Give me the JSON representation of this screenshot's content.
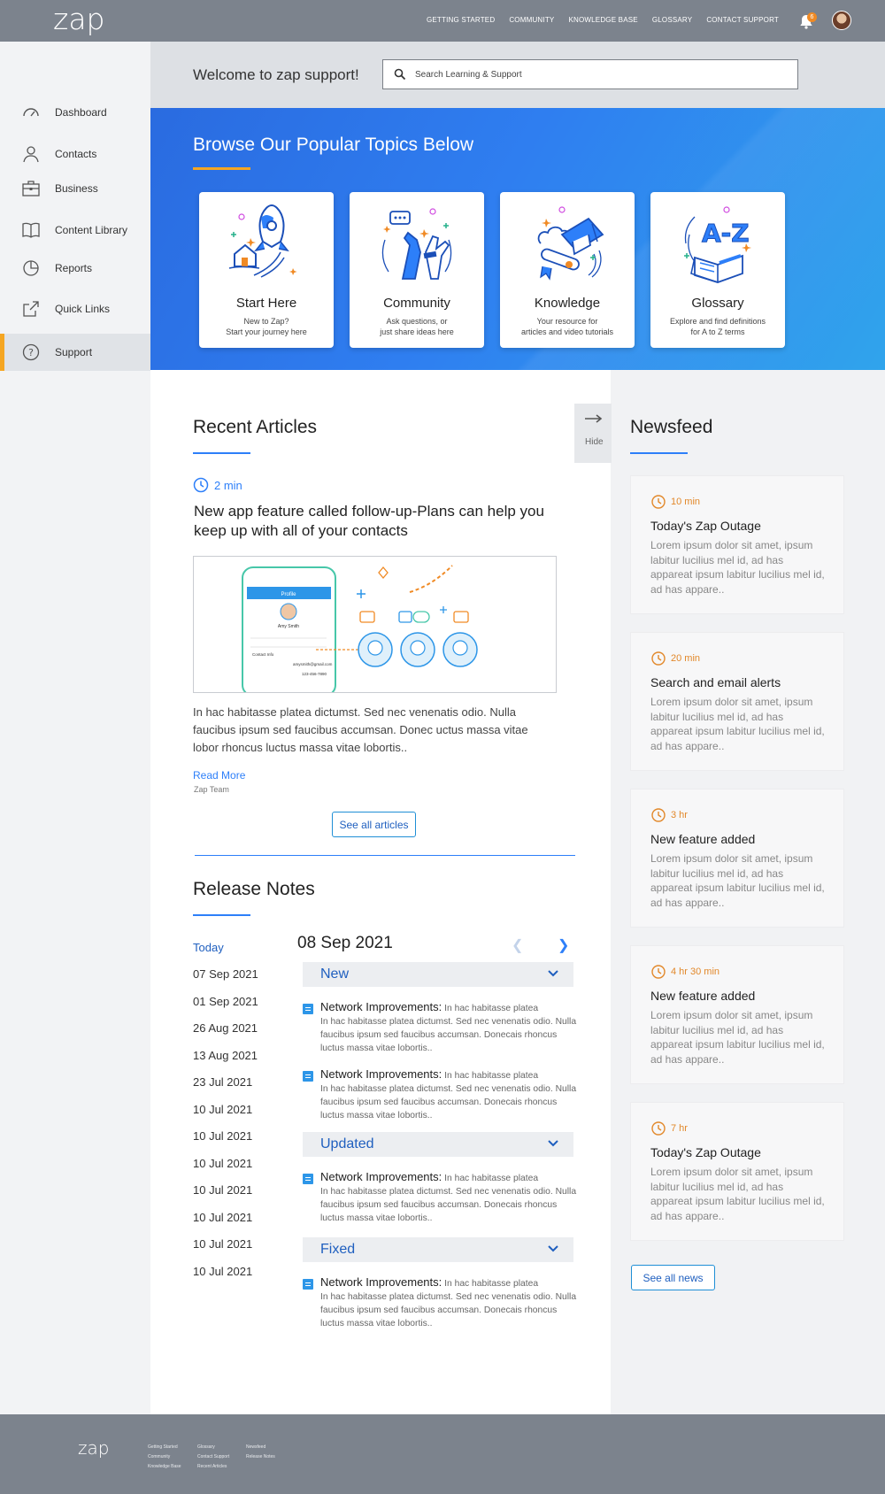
{
  "header": {
    "logo": "zap",
    "nav": [
      "GETTING STARTED",
      "COMMUNITY",
      "KNOWLEDGE BASE",
      "GLOSSARY",
      "CONTACT SUPPORT"
    ],
    "notification_count": "6"
  },
  "sidebar": {
    "items": [
      {
        "label": "Dashboard",
        "icon": "speedometer-icon"
      },
      {
        "label": "Contacts",
        "icon": "person-icon"
      },
      {
        "label": "Business",
        "icon": "briefcase-icon"
      },
      {
        "label": "Content Library",
        "icon": "book-icon"
      },
      {
        "label": "Reports",
        "icon": "pie-chart-icon"
      },
      {
        "label": "Quick Links",
        "icon": "external-link-icon"
      },
      {
        "label": "Support",
        "icon": "question-icon"
      }
    ],
    "active": "Support",
    "accent": "#f5a623"
  },
  "welcome": {
    "text": "Welcome to zap support!",
    "search_placeholder": "Search Learning & Support"
  },
  "hero": {
    "title": "Browse Our Popular Topics Below",
    "cards": [
      {
        "title": "Start Here",
        "desc": "New to Zap?\nStart your journey here",
        "icon": "rocket-icon"
      },
      {
        "title": "Community",
        "desc": "Ask questions,  or\njust share ideas here",
        "icon": "high-five-icon"
      },
      {
        "title": "Knowledge",
        "desc": "Your resource for\narticles and video tutorials",
        "icon": "graduation-cap-icon"
      },
      {
        "title": "Glossary",
        "desc": "Explore and find definitions\nfor A to Z terms",
        "icon": "a-z-book-icon"
      }
    ]
  },
  "recent": {
    "heading": "Recent Articles",
    "time": "2 min",
    "title": "New app feature called follow-up-Plans can help you keep up with all of your contacts",
    "body": "In hac habitasse platea dictumst. Sed nec venenatis odio. Nulla faucibus ipsum sed faucibus accumsan. Donec uctus massa vitae lobor rhoncus luctus massa vitae lobortis..",
    "read_more": "Read More",
    "author": "Zap Team",
    "see_all": "See all articles",
    "image_text": {
      "profile": "Profile",
      "name": "Amy Smith",
      "contact_info": "Contact Info",
      "email": "amysmith@gmail.com",
      "phone": "123-456-7890"
    }
  },
  "release": {
    "heading": "Release Notes",
    "dates": [
      "Today",
      "07 Sep 2021",
      "01 Sep 2021",
      "26 Aug 2021",
      "13 Aug 2021",
      "23 Jul 2021",
      "10 Jul 2021",
      "10 Jul 2021",
      "10 Jul 2021",
      "10 Jul 2021",
      "10 Jul 2021",
      "10 Jul 2021",
      "10 Jul 2021"
    ],
    "current_date": "08 Sep 2021",
    "sections": [
      {
        "label": "New"
      },
      {
        "label": "Updated"
      },
      {
        "label": "Fixed"
      }
    ],
    "item_title": "Network Improvements:",
    "item_lead": "In hac habitasse platea",
    "item_body": "In hac habitasse platea dictumst. Sed nec venenatis odio. Nulla faucibus ipsum sed faucibus accumsan. Donecais rhoncus luctus massa vitae lobortis.."
  },
  "newsfeed": {
    "heading": "Newsfeed",
    "hide_label": "Hide",
    "items": [
      {
        "time": "10 min",
        "title": "Today's Zap Outage",
        "body": "Lorem ipsum dolor sit amet, ipsum labitur lucilius mel id, ad has appareat ipsum labitur lucilius mel id, ad has appare.."
      },
      {
        "time": "20 min",
        "title": "Search and email alerts",
        "body": "Lorem ipsum dolor sit amet, ipsum labitur lucilius mel id, ad has appareat ipsum labitur lucilius mel id, ad has appare.."
      },
      {
        "time": "3 hr",
        "title": "New feature added",
        "body": "Lorem ipsum dolor sit amet, ipsum labitur lucilius mel id, ad has appareat ipsum labitur lucilius mel id, ad has appare.."
      },
      {
        "time": "4 hr 30 min",
        "title": "New feature added",
        "body": "Lorem ipsum dolor sit amet, ipsum labitur lucilius mel id, ad has appareat ipsum labitur lucilius mel id, ad has appare.."
      },
      {
        "time": "7 hr",
        "title": "Today's Zap Outage",
        "body": "Lorem ipsum dolor sit amet, ipsum labitur lucilius mel id, ad has appareat ipsum labitur lucilius mel id, ad has appare.."
      }
    ],
    "see_all": "See all news"
  },
  "footer": {
    "logo": "zap",
    "col1": [
      "Getting Started",
      "Community",
      "Knowledge Base"
    ],
    "col2": [
      "Glossary",
      "Contact Support",
      "Recent Articles"
    ],
    "col3": [
      "Newsfeed",
      "Release Notes"
    ]
  },
  "colors": {
    "header": "#7c838d",
    "accent_blue": "#2d7ff9",
    "accent_orange": "#f5a623",
    "news_time": "#e2882a"
  }
}
